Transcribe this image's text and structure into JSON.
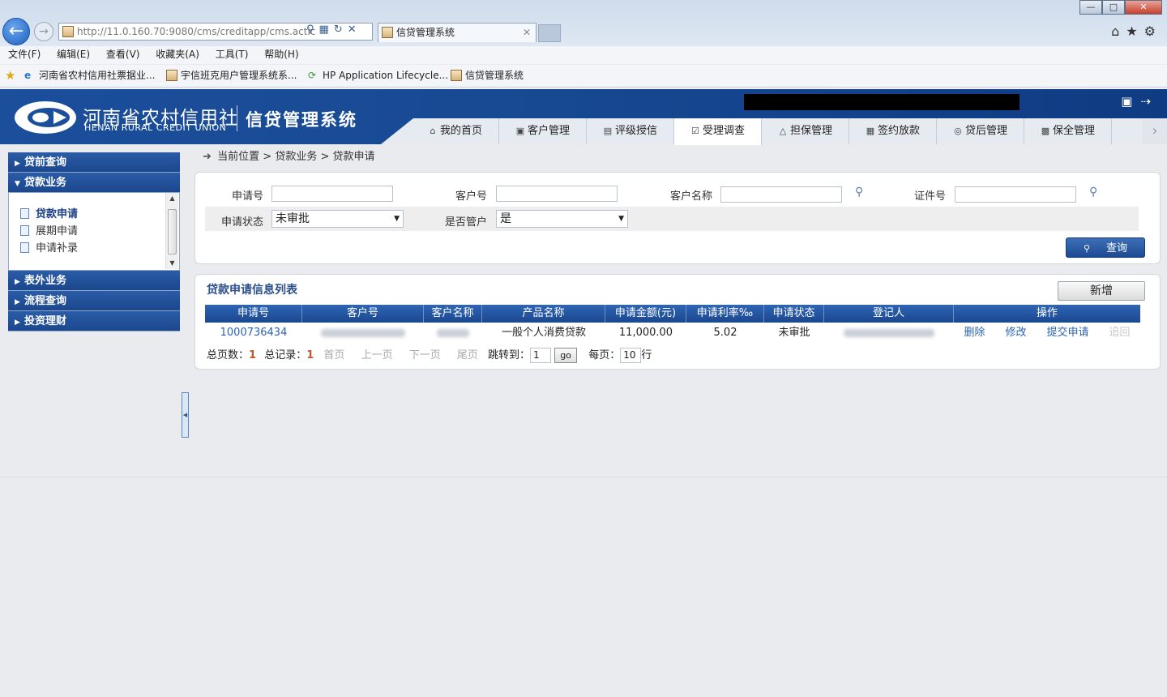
{
  "browser": {
    "url": "http://11.0.160.70:9080/cms/creditapp/cms.actic",
    "tab_title": "信贷管理系统",
    "menu": [
      "文件(F)",
      "编辑(E)",
      "查看(V)",
      "收藏夹(A)",
      "工具(T)",
      "帮助(H)"
    ],
    "favorites": [
      "河南省农村信用社票据业...",
      "宇信班克用户管理系统系...",
      "HP Application Lifecycle...",
      "信贷管理系统"
    ]
  },
  "app": {
    "logo_cn": "河南省农村信用社",
    "logo_en": "HENAN RURAL CREDIT UNION",
    "system_name": "信贷管理系统",
    "nav_tabs": [
      "我的首页",
      "客户管理",
      "评级授信",
      "受理调查",
      "担保管理",
      "签约放款",
      "贷后管理",
      "保全管理"
    ],
    "active_tab": "受理调查"
  },
  "sidebar": {
    "groups": [
      "贷前查询",
      "贷款业务",
      "表外业务",
      "流程查询",
      "投资理财"
    ],
    "items": [
      "贷款申请",
      "展期申请",
      "申请补录"
    ]
  },
  "breadcrumb": {
    "root": "当前位置",
    "level1": "贷款业务",
    "level2": "贷款申请"
  },
  "search": {
    "label_app_no": "申请号",
    "label_cust_no": "客户号",
    "label_cust_name": "客户名称",
    "label_id_no": "证件号",
    "label_status": "申请状态",
    "status_value": "未审批",
    "label_manager": "是否管户",
    "manager_value": "是",
    "query_button": "查询"
  },
  "list": {
    "title": "贷款申请信息列表",
    "add_button": "新增",
    "columns": [
      "申请号",
      "客户号",
      "客户名称",
      "产品名称",
      "申请金额(元)",
      "申请利率‰",
      "申请状态",
      "登记人",
      "操作"
    ],
    "rows": [
      {
        "app_no": "1000736434",
        "product": "一般个人消费贷款",
        "amount": "11,000.00",
        "rate": "5.02",
        "status": "未审批",
        "actions": [
          "删除",
          "修改",
          "提交申请",
          "追回"
        ]
      }
    ]
  },
  "pager": {
    "total_pages_label": "总页数：",
    "total_pages": "1",
    "total_records_label": "总记录：",
    "total_records": "1",
    "first": "首页",
    "prev": "上一页",
    "next": "下一页",
    "last": "尾页",
    "jump_label": "跳转到：",
    "jump_value": "1",
    "go_label": "go",
    "per_page_label": "每页：",
    "per_page_value": "10",
    "per_page_unit": "行"
  }
}
